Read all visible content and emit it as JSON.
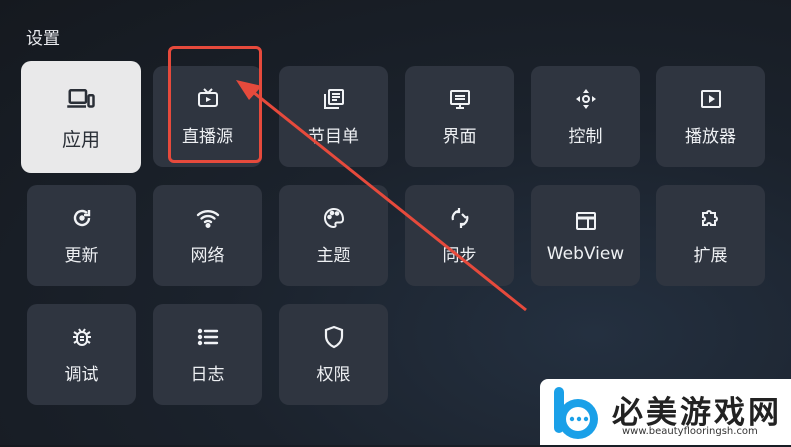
{
  "page": {
    "title": "设置"
  },
  "tiles": [
    {
      "label": "应用",
      "icon": "devices-icon"
    },
    {
      "label": "直播源",
      "icon": "tv-icon"
    },
    {
      "label": "节目单",
      "icon": "library-icon"
    },
    {
      "label": "界面",
      "icon": "monitor-icon"
    },
    {
      "label": "控制",
      "icon": "dpad-icon"
    },
    {
      "label": "播放器",
      "icon": "play-box-icon"
    },
    {
      "label": "更新",
      "icon": "refresh-icon"
    },
    {
      "label": "网络",
      "icon": "wifi-icon"
    },
    {
      "label": "主题",
      "icon": "palette-icon"
    },
    {
      "label": "同步",
      "icon": "sync-icon"
    },
    {
      "label": "WebView",
      "icon": "web-window-icon"
    },
    {
      "label": "扩展",
      "icon": "puzzle-icon"
    },
    {
      "label": "调试",
      "icon": "bug-icon"
    },
    {
      "label": "日志",
      "icon": "list-icon"
    },
    {
      "label": "权限",
      "icon": "shield-icon"
    }
  ],
  "annotation": {
    "color": "#e64a3c"
  },
  "watermark": {
    "text": "必美游戏网",
    "url": "www.beautyflooringsh.com"
  }
}
